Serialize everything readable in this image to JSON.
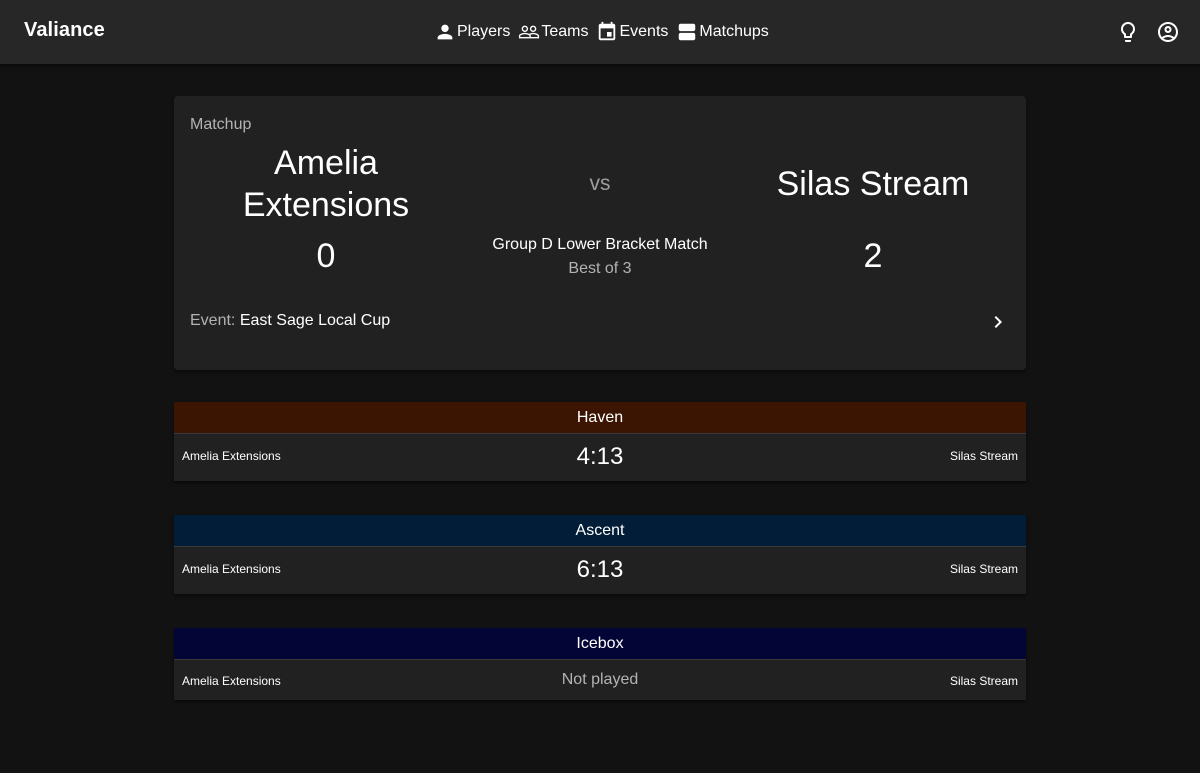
{
  "app": {
    "title": "Valiance"
  },
  "nav": [
    {
      "label": "Players",
      "icon": "person-icon"
    },
    {
      "label": "Teams",
      "icon": "group-icon"
    },
    {
      "label": "Events",
      "icon": "calendar-icon"
    },
    {
      "label": "Matchups",
      "icon": "matchups-icon"
    }
  ],
  "matchup": {
    "label": "Matchup",
    "team1": "Amelia Extensions",
    "team2": "Silas Stream",
    "vs": "vs",
    "score1": "0",
    "score2": "2",
    "title": "Group D Lower Bracket Match",
    "format": "Best of 3",
    "event_label": "Event:",
    "event_name": "East Sage Local Cup"
  },
  "maps": [
    {
      "name": "Haven",
      "color": "#3b1502",
      "team1": "Amelia Extensions",
      "team2": "Silas Stream",
      "score": "4:13",
      "status": ""
    },
    {
      "name": "Ascent",
      "color": "#021d37",
      "team1": "Amelia Extensions",
      "team2": "Silas Stream",
      "score": "6:13",
      "status": ""
    },
    {
      "name": "Icebox",
      "color": "#020536",
      "team1": "Amelia Extensions",
      "team2": "Silas Stream",
      "score": "",
      "status": "Not played"
    }
  ],
  "colors": {
    "appbar": "#272727",
    "background": "#121212",
    "card": "#212121"
  }
}
